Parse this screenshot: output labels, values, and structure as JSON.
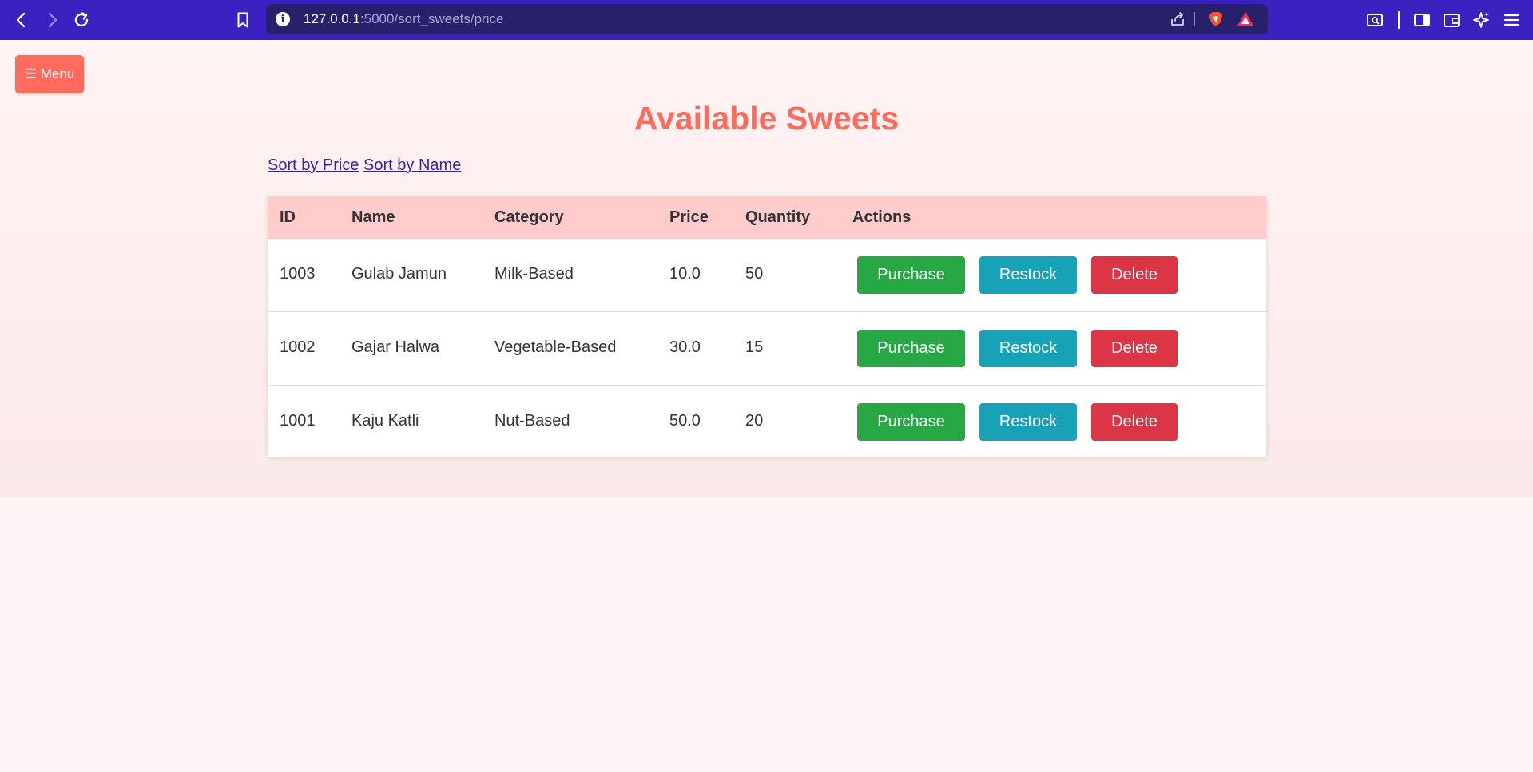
{
  "browser": {
    "url_host": "127.0.0.1",
    "url_path": ":5000/sort_sweets/price"
  },
  "menu": {
    "label": "☰ Menu"
  },
  "page": {
    "title": "Available Sweets",
    "sort_price_label": "Sort by Price",
    "sort_name_label": "Sort by Name"
  },
  "table": {
    "headers": [
      "ID",
      "Name",
      "Category",
      "Price",
      "Quantity",
      "Actions"
    ],
    "rows": [
      {
        "id": "1003",
        "name": "Gulab Jamun",
        "category": "Milk-Based",
        "price": "10.0",
        "quantity": "50"
      },
      {
        "id": "1002",
        "name": "Gajar Halwa",
        "category": "Vegetable-Based",
        "price": "30.0",
        "quantity": "15"
      },
      {
        "id": "1001",
        "name": "Kaju Katli",
        "category": "Nut-Based",
        "price": "50.0",
        "quantity": "20"
      }
    ],
    "actions": {
      "purchase": "Purchase",
      "restock": "Restock",
      "delete": "Delete"
    }
  },
  "colors": {
    "toolbar": "#3b22c0",
    "accent": "#ff6b5c",
    "header_row": "#ffcccb",
    "purchase": "#28a745",
    "restock": "#17a2b8",
    "delete": "#dc3545"
  },
  "icons": {
    "toolbar_left": [
      "back-icon",
      "forward-icon",
      "reload-icon",
      "bookmark-icon"
    ],
    "url_bar": [
      "site-info-icon",
      "share-icon",
      "brave-shield-icon",
      "brave-rewards-icon"
    ],
    "toolbar_right": [
      "search-tab-icon",
      "sidebar-icon",
      "wallet-icon",
      "leo-ai-icon",
      "main-menu-icon"
    ]
  }
}
